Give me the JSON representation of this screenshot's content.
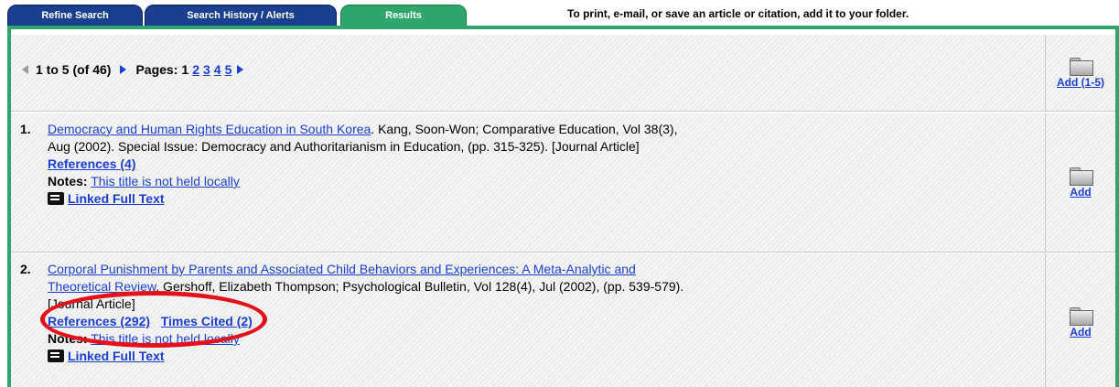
{
  "tabs": [
    {
      "label": "Refine Search"
    },
    {
      "label": "Search History / Alerts"
    },
    {
      "label": "Results"
    }
  ],
  "notice": "To print, e-mail, or save an article or citation, add it to your folder.",
  "pager": {
    "range": "1 to 5",
    "of": "(of 46)",
    "pages_label": "Pages:",
    "current_page": "1",
    "pages": [
      "2",
      "3",
      "4",
      "5"
    ],
    "add_all": "Add (1-5)"
  },
  "results": [
    {
      "number": "1.",
      "title": "Democracy and Human Rights Education in South Korea",
      "citation_line1": ". Kang, Soon-Won; Comparative Education, Vol 38(3),",
      "citation_line2": "Aug (2002). Special Issue: Democracy and Authoritarianism in Education, (pp. 315-325). [Journal Article]",
      "references": "References (4)",
      "notes_label": "Notes:",
      "notes_value": "This title is not held locally",
      "fulltext": "Linked Full Text",
      "add": "Add"
    },
    {
      "number": "2.",
      "title_line1": "Corporal Punishment by Parents and Associated Child Behaviors and Experiences: A Meta-Analytic and",
      "title_line2": "Theoretical Review",
      "citation_line2": ". Gershoff, Elizabeth Thompson; Psychological Bulletin, Vol 128(4), Jul (2002), (pp. 539-579).",
      "citation_line3": "[Journal Article]",
      "references": "References (292)",
      "times_cited": "Times Cited (2)",
      "notes_label": "Notes:",
      "notes_value": "This title is not held locally",
      "fulltext": "Linked Full Text",
      "add": "Add"
    }
  ],
  "colors": {
    "tab_blue": "#1a3f8f",
    "tab_green": "#2ea56b",
    "link_blue": "#1c3fd1",
    "highlight_red": "#e3121a"
  },
  "icons": [
    "prev-arrow-icon",
    "next-arrow-icon",
    "folder-icon",
    "fulltext-book-icon"
  ]
}
